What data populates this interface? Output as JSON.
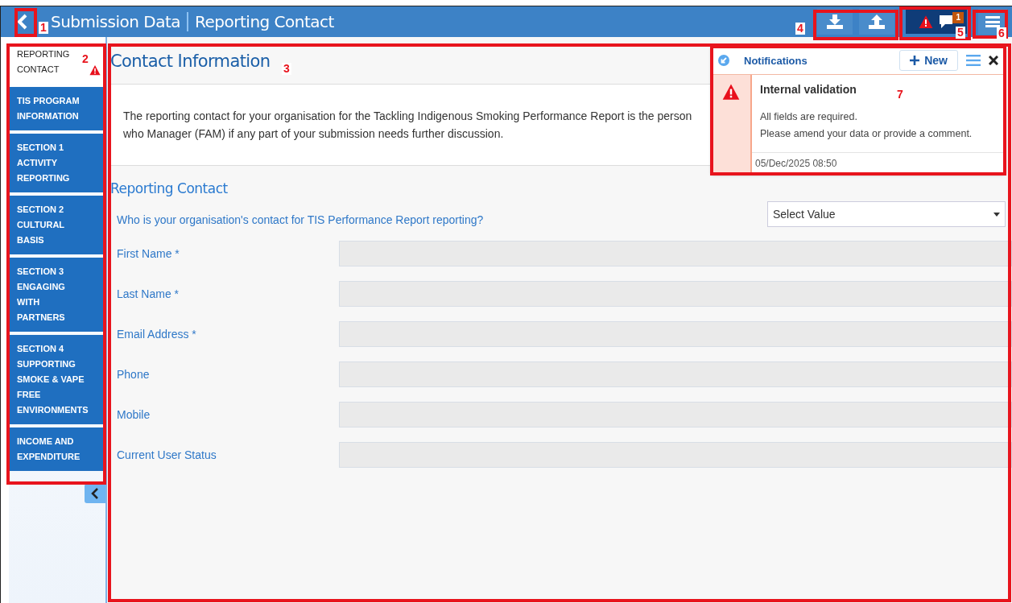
{
  "header": {
    "title": "Submission Data",
    "subtitle": "Reporting Contact",
    "alert_badge": "1"
  },
  "sidebar": {
    "items": [
      {
        "label": "REPORTING CONTACT",
        "selected": true,
        "warning": true
      },
      {
        "label": "TIS PROGRAM INFORMATION",
        "selected": false,
        "warning": false
      },
      {
        "label": "SECTION 1 ACTIVITY REPORTING",
        "selected": false,
        "warning": false
      },
      {
        "label": "SECTION 2 CULTURAL BASIS",
        "selected": false,
        "warning": false
      },
      {
        "label": "SECTION 3 ENGAGING WITH PARTNERS",
        "selected": false,
        "warning": false
      },
      {
        "label": "SECTION 4 SUPPORTING SMOKE & VAPE FREE ENVIRONMENTS",
        "selected": false,
        "warning": false
      },
      {
        "label": "INCOME AND EXPENDITURE",
        "selected": false,
        "warning": false
      }
    ]
  },
  "content": {
    "title": "Contact Information",
    "intro": "The reporting contact for your organisation for the Tackling Indigenous Smoking Performance Report is the person who Manager (FAM) if any part of your submission needs further discussion.",
    "section": "Reporting Contact",
    "question": "Who is your organisation's contact for TIS Performance Report reporting?",
    "select": {
      "value": "Select Value"
    },
    "fields": [
      {
        "label": "First Name *"
      },
      {
        "label": "Last Name *"
      },
      {
        "label": "Email Address *"
      },
      {
        "label": "Phone"
      },
      {
        "label": "Mobile"
      },
      {
        "label": "Current User Status"
      }
    ]
  },
  "notifications": {
    "title": "Notifications",
    "new_button": "New",
    "message": {
      "title": "Internal validation",
      "lines": [
        "All fields are required.",
        "Please amend your data or provide a comment."
      ],
      "time": "05/Dec/2025 08:50"
    }
  },
  "annotations": [
    {
      "number": "1"
    },
    {
      "number": "2"
    },
    {
      "number": "3"
    },
    {
      "number": "4"
    },
    {
      "number": "5"
    },
    {
      "number": "6"
    },
    {
      "number": "7"
    }
  ]
}
